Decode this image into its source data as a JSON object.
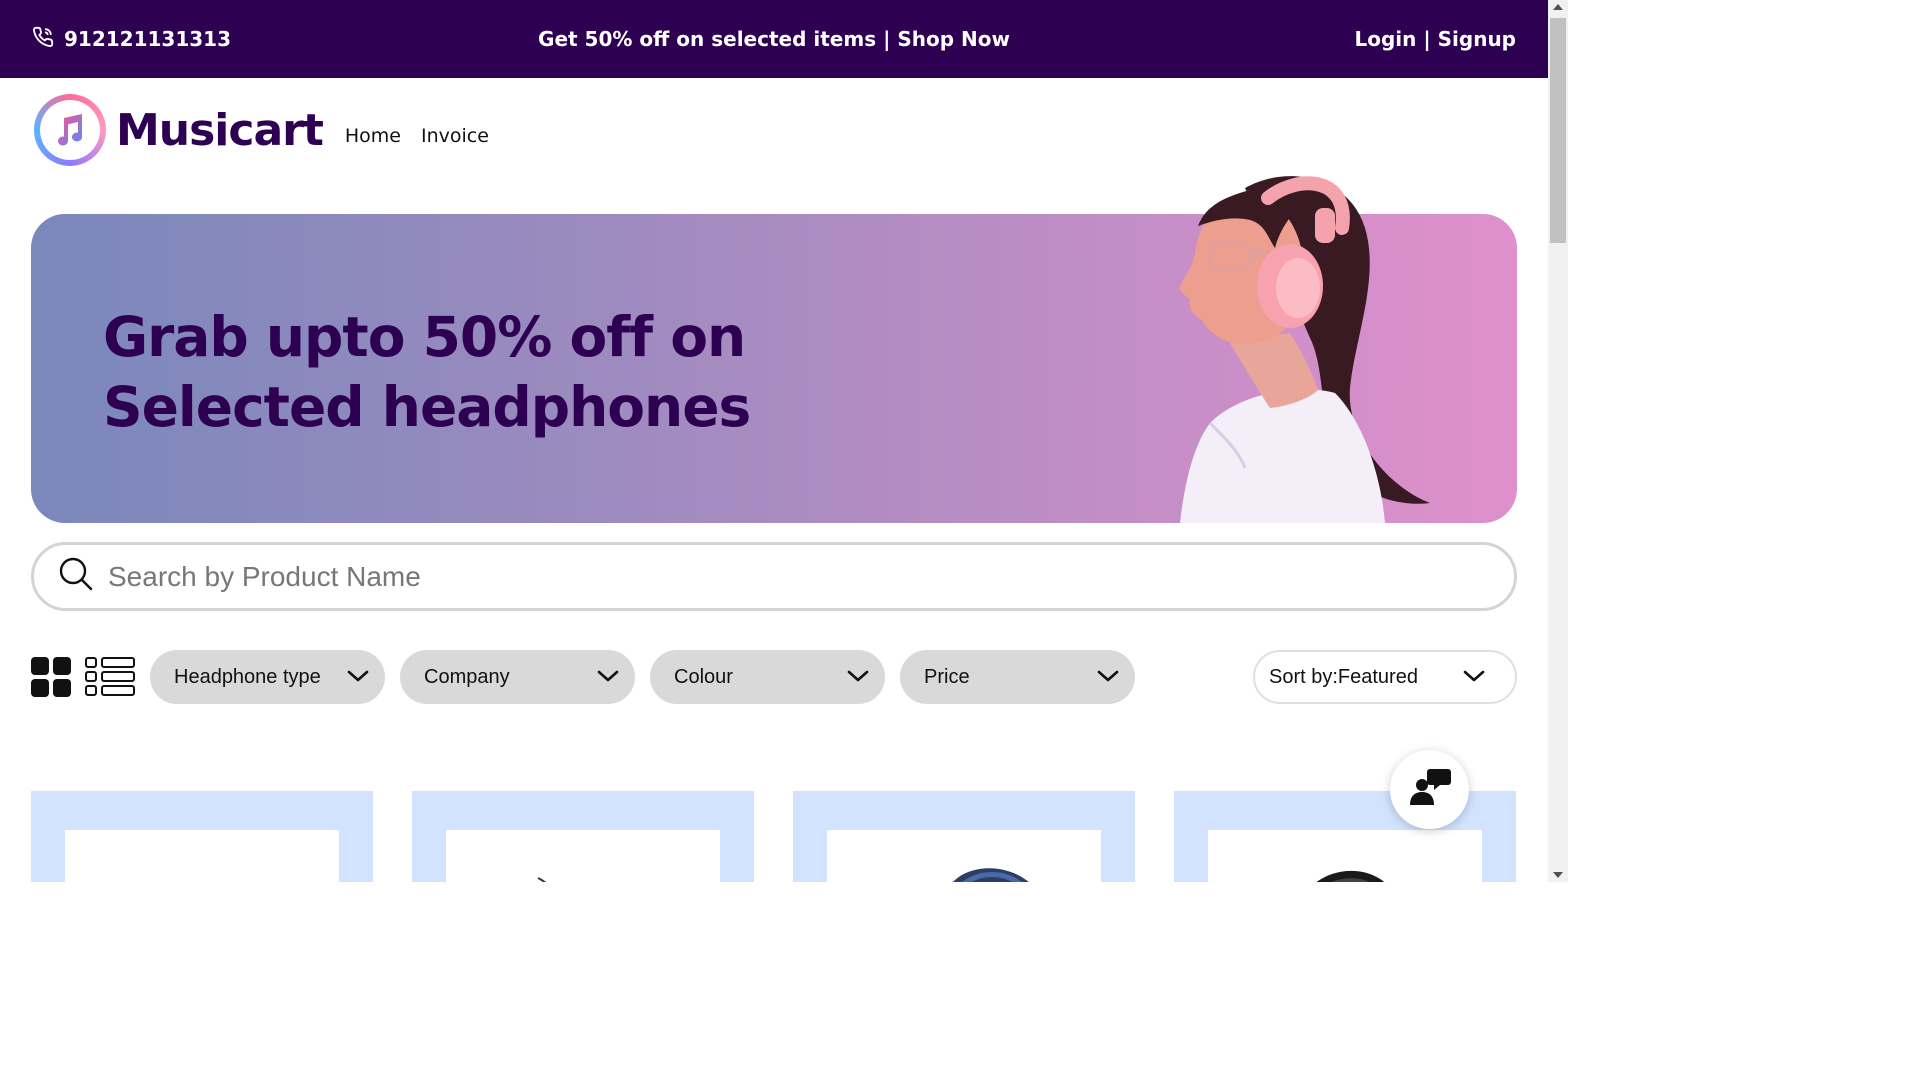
{
  "topbar": {
    "phone": "912121131313",
    "promo": "Get 50% off on selected items | Shop Now",
    "login": "Login",
    "separator": " | ",
    "signup": "Signup"
  },
  "header": {
    "brand": "Musicart",
    "nav": [
      "Home",
      "Invoice"
    ]
  },
  "hero": {
    "line1": "Grab upto 50% off on",
    "line2": "Selected headphones"
  },
  "search": {
    "placeholder": "Search by Product Name"
  },
  "filters": {
    "headphone_type": "Headphone type",
    "company": "Company",
    "colour": "Colour",
    "price": "Price",
    "sort": "Sort by:Featured"
  },
  "colors": {
    "brand_dark": "#2e0052",
    "card_bg": "#d1e3ff",
    "dropdown_bg": "#d9d9d9"
  }
}
